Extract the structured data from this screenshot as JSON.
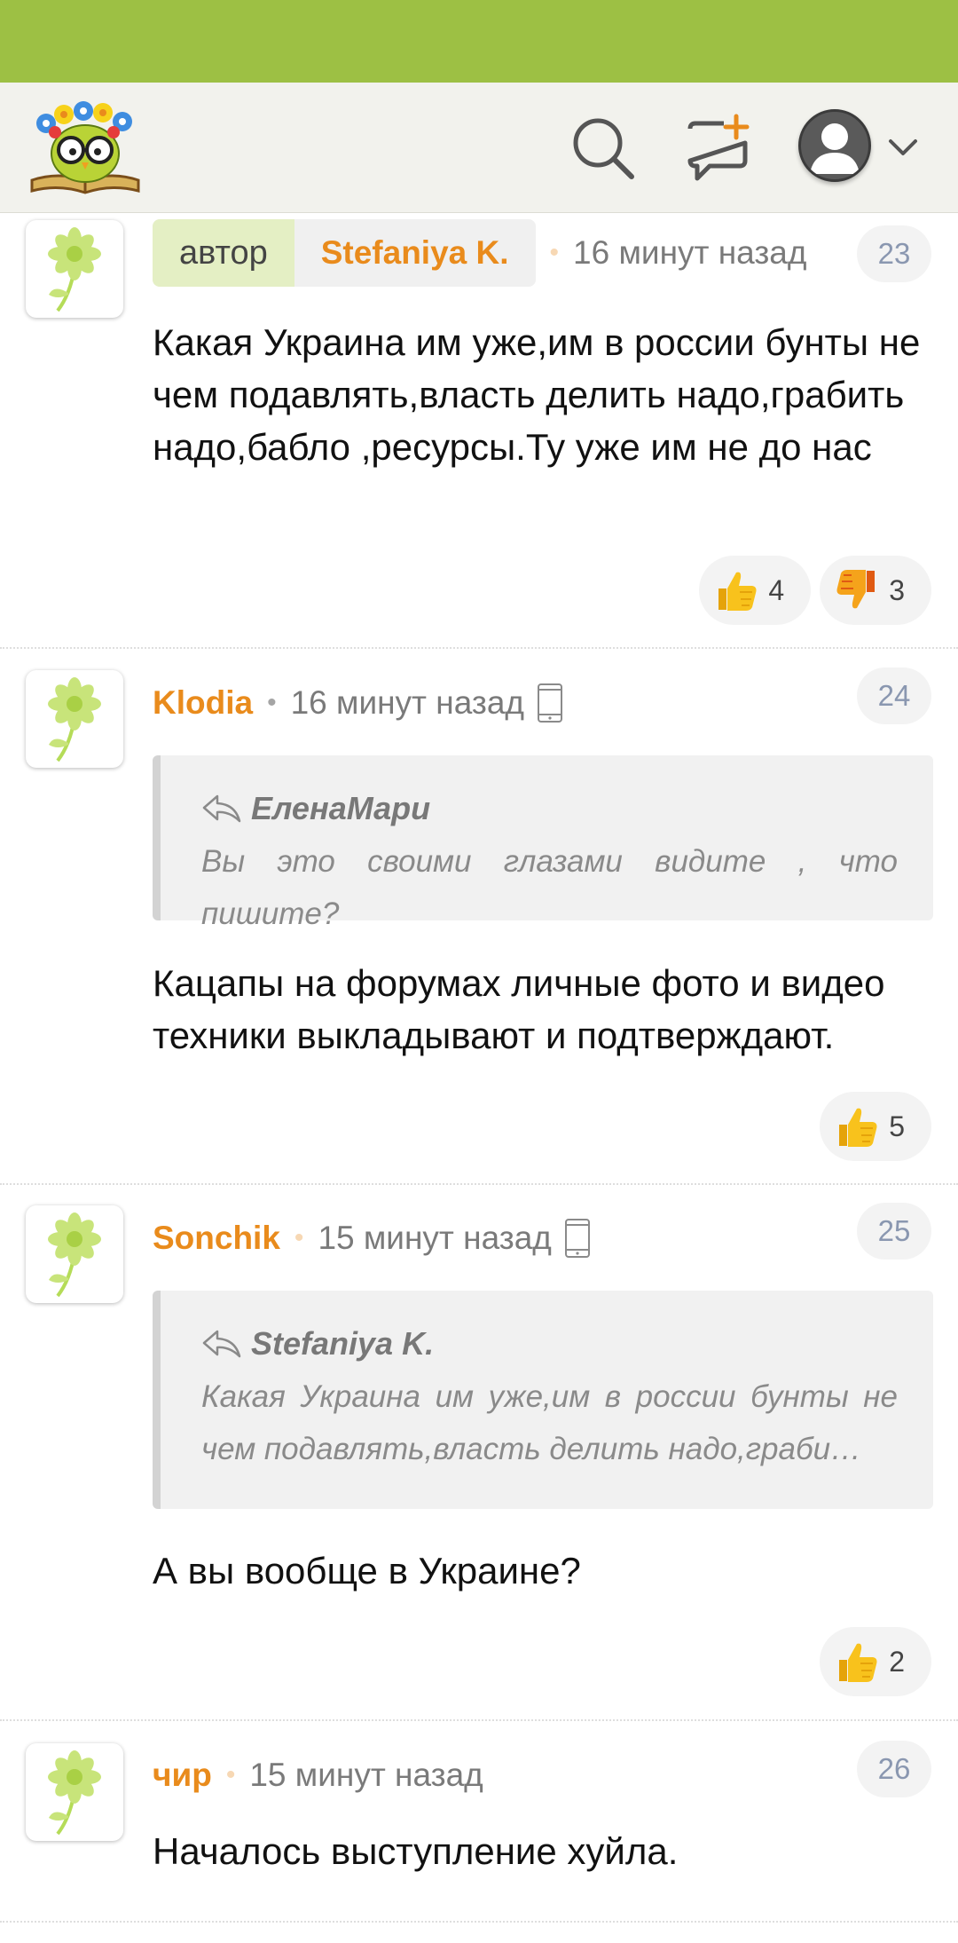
{
  "header": {
    "logo": "owl-books-logo",
    "icons": [
      "search-icon",
      "new-post-icon",
      "user-avatar-icon",
      "chevron-down-icon"
    ]
  },
  "comments": [
    {
      "author_tag": "автор",
      "author": "Stefaniya K.",
      "time": "16 минут назад",
      "number": "23",
      "text": "Какая Украина им уже,им в россии бунты не чем подавлять,власть делить надо,грабить надо,бабло ,ресурсы.Ту уже им не до нас",
      "likes": "4",
      "dislikes": "3"
    },
    {
      "author": "Klodia",
      "time": "16 минут назад",
      "number": "24",
      "quote_author": "ЕленаМари",
      "quote_text": "Вы это своими глазами видите , что пишите?",
      "text": "Кацапы на форумах личные фото и видео техники выкладывают и подтверждают.",
      "likes": "5"
    },
    {
      "author": "Sonchik",
      "time": "15 минут назад",
      "number": "25",
      "quote_author": "Stefaniya K.",
      "quote_text": "Какая Украина им уже,им в россии бунты не чем подавлять,власть делить надо,граби…",
      "text": "А вы вообще в Украине?",
      "likes": "2"
    },
    {
      "author": "чир",
      "time": "15 минут назад",
      "number": "26",
      "text": "Началось выступление хуйла."
    }
  ],
  "colors": {
    "status_bar": "#9dc044",
    "header_bg": "#f2f2ed",
    "username": "#e98b1c",
    "author_tag_bg": "#e4efc4"
  }
}
